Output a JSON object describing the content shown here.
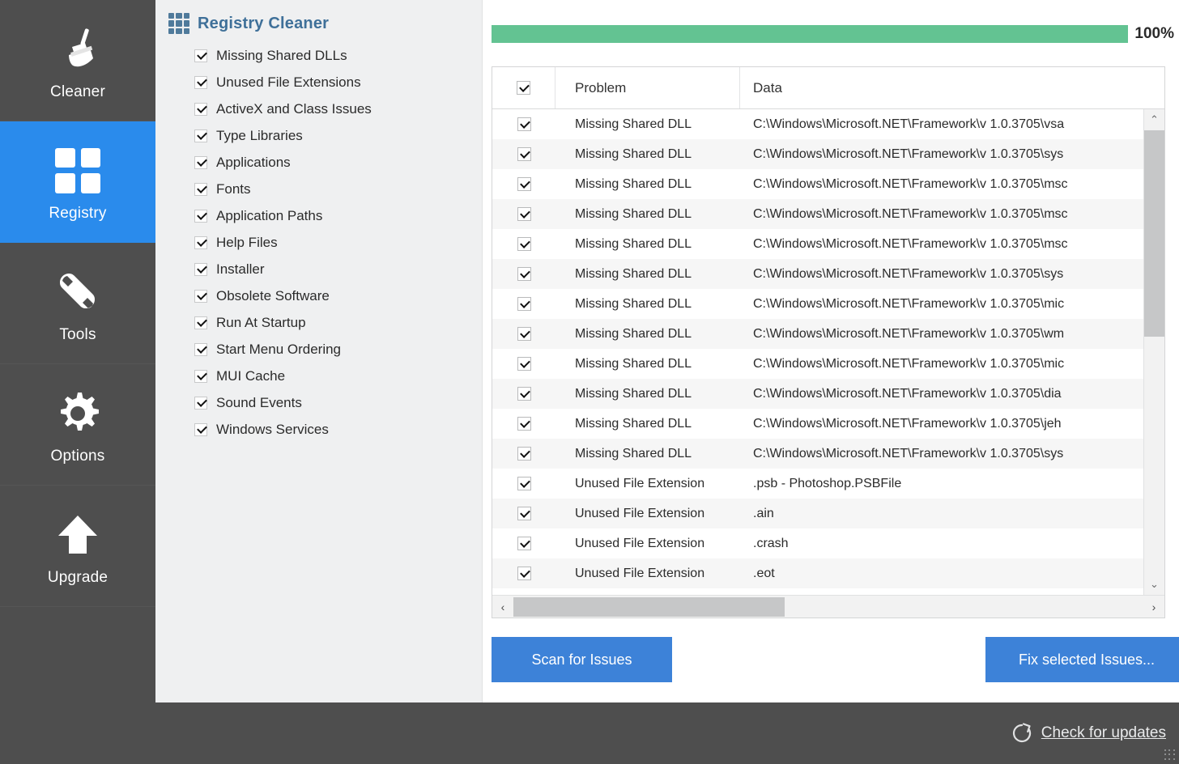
{
  "sidebar": {
    "items": [
      {
        "label": "Cleaner",
        "icon": "broom-icon",
        "selected": false
      },
      {
        "label": "Registry",
        "icon": "grid-icon",
        "selected": true
      },
      {
        "label": "Tools",
        "icon": "wrench-icon",
        "selected": false
      },
      {
        "label": "Options",
        "icon": "gear-icon",
        "selected": false
      },
      {
        "label": "Upgrade",
        "icon": "up-arrow-icon",
        "selected": false
      }
    ],
    "selected_color": "#2a8bec",
    "background_color": "#4e4e4e"
  },
  "options_panel": {
    "title": "Registry Cleaner",
    "title_color": "#3f7099",
    "icon": "grid-3x3-icon",
    "items": [
      {
        "label": "Missing Shared DLLs",
        "checked": true
      },
      {
        "label": "Unused File Extensions",
        "checked": true
      },
      {
        "label": "ActiveX and Class Issues",
        "checked": true
      },
      {
        "label": "Type Libraries",
        "checked": true
      },
      {
        "label": "Applications",
        "checked": true
      },
      {
        "label": "Fonts",
        "checked": true
      },
      {
        "label": "Application Paths",
        "checked": true
      },
      {
        "label": "Help Files",
        "checked": true
      },
      {
        "label": "Installer",
        "checked": true
      },
      {
        "label": "Obsolete Software",
        "checked": true
      },
      {
        "label": "Run At Startup",
        "checked": true
      },
      {
        "label": "Start Menu Ordering",
        "checked": true
      },
      {
        "label": "MUI Cache",
        "checked": true
      },
      {
        "label": "Sound Events",
        "checked": true
      },
      {
        "label": "Windows Services",
        "checked": true
      }
    ]
  },
  "progress": {
    "percent_label": "100%",
    "percent_value": 100,
    "fill_color": "#63c392"
  },
  "results_table": {
    "headers": {
      "checkbox": "select-all",
      "problem": "Problem",
      "data": "Data"
    },
    "select_all_checked": true,
    "rows": [
      {
        "checked": true,
        "problem": "Missing Shared DLL",
        "data": "C:\\Windows\\Microsoft.NET\\Framework\\v 1.0.3705\\vsa"
      },
      {
        "checked": true,
        "problem": "Missing Shared DLL",
        "data": "C:\\Windows\\Microsoft.NET\\Framework\\v 1.0.3705\\sys"
      },
      {
        "checked": true,
        "problem": "Missing Shared DLL",
        "data": "C:\\Windows\\Microsoft.NET\\Framework\\v 1.0.3705\\msc"
      },
      {
        "checked": true,
        "problem": "Missing Shared DLL",
        "data": "C:\\Windows\\Microsoft.NET\\Framework\\v 1.0.3705\\msc"
      },
      {
        "checked": true,
        "problem": "Missing Shared DLL",
        "data": "C:\\Windows\\Microsoft.NET\\Framework\\v 1.0.3705\\msc"
      },
      {
        "checked": true,
        "problem": "Missing Shared DLL",
        "data": "C:\\Windows\\Microsoft.NET\\Framework\\v 1.0.3705\\sys"
      },
      {
        "checked": true,
        "problem": "Missing Shared DLL",
        "data": "C:\\Windows\\Microsoft.NET\\Framework\\v 1.0.3705\\mic"
      },
      {
        "checked": true,
        "problem": "Missing Shared DLL",
        "data": "C:\\Windows\\Microsoft.NET\\Framework\\v 1.0.3705\\wm"
      },
      {
        "checked": true,
        "problem": "Missing Shared DLL",
        "data": "C:\\Windows\\Microsoft.NET\\Framework\\v 1.0.3705\\mic"
      },
      {
        "checked": true,
        "problem": "Missing Shared DLL",
        "data": "C:\\Windows\\Microsoft.NET\\Framework\\v 1.0.3705\\dia"
      },
      {
        "checked": true,
        "problem": "Missing Shared DLL",
        "data": "C:\\Windows\\Microsoft.NET\\Framework\\v 1.0.3705\\jeh"
      },
      {
        "checked": true,
        "problem": "Missing Shared DLL",
        "data": "C:\\Windows\\Microsoft.NET\\Framework\\v 1.0.3705\\sys"
      },
      {
        "checked": true,
        "problem": "Unused File Extension",
        "data": ".psb - Photoshop.PSBFile"
      },
      {
        "checked": true,
        "problem": "Unused File Extension",
        "data": ".ain"
      },
      {
        "checked": true,
        "problem": "Unused File Extension",
        "data": ".crash"
      },
      {
        "checked": true,
        "problem": "Unused File Extension",
        "data": ".eot"
      }
    ],
    "vertical_scrollbar": {
      "up_arrow": "⌃",
      "down_arrow": "⌄"
    },
    "horizontal_scrollbar": {
      "left_arrow": "‹",
      "right_arrow": "›"
    }
  },
  "buttons": {
    "scan": "Scan for Issues",
    "fix": "Fix selected Issues...",
    "accent_color": "#3d82d8"
  },
  "footer": {
    "updates_label": "Check for updates",
    "updates_icon": "refresh-icon",
    "background_color": "#4e4e4e"
  }
}
